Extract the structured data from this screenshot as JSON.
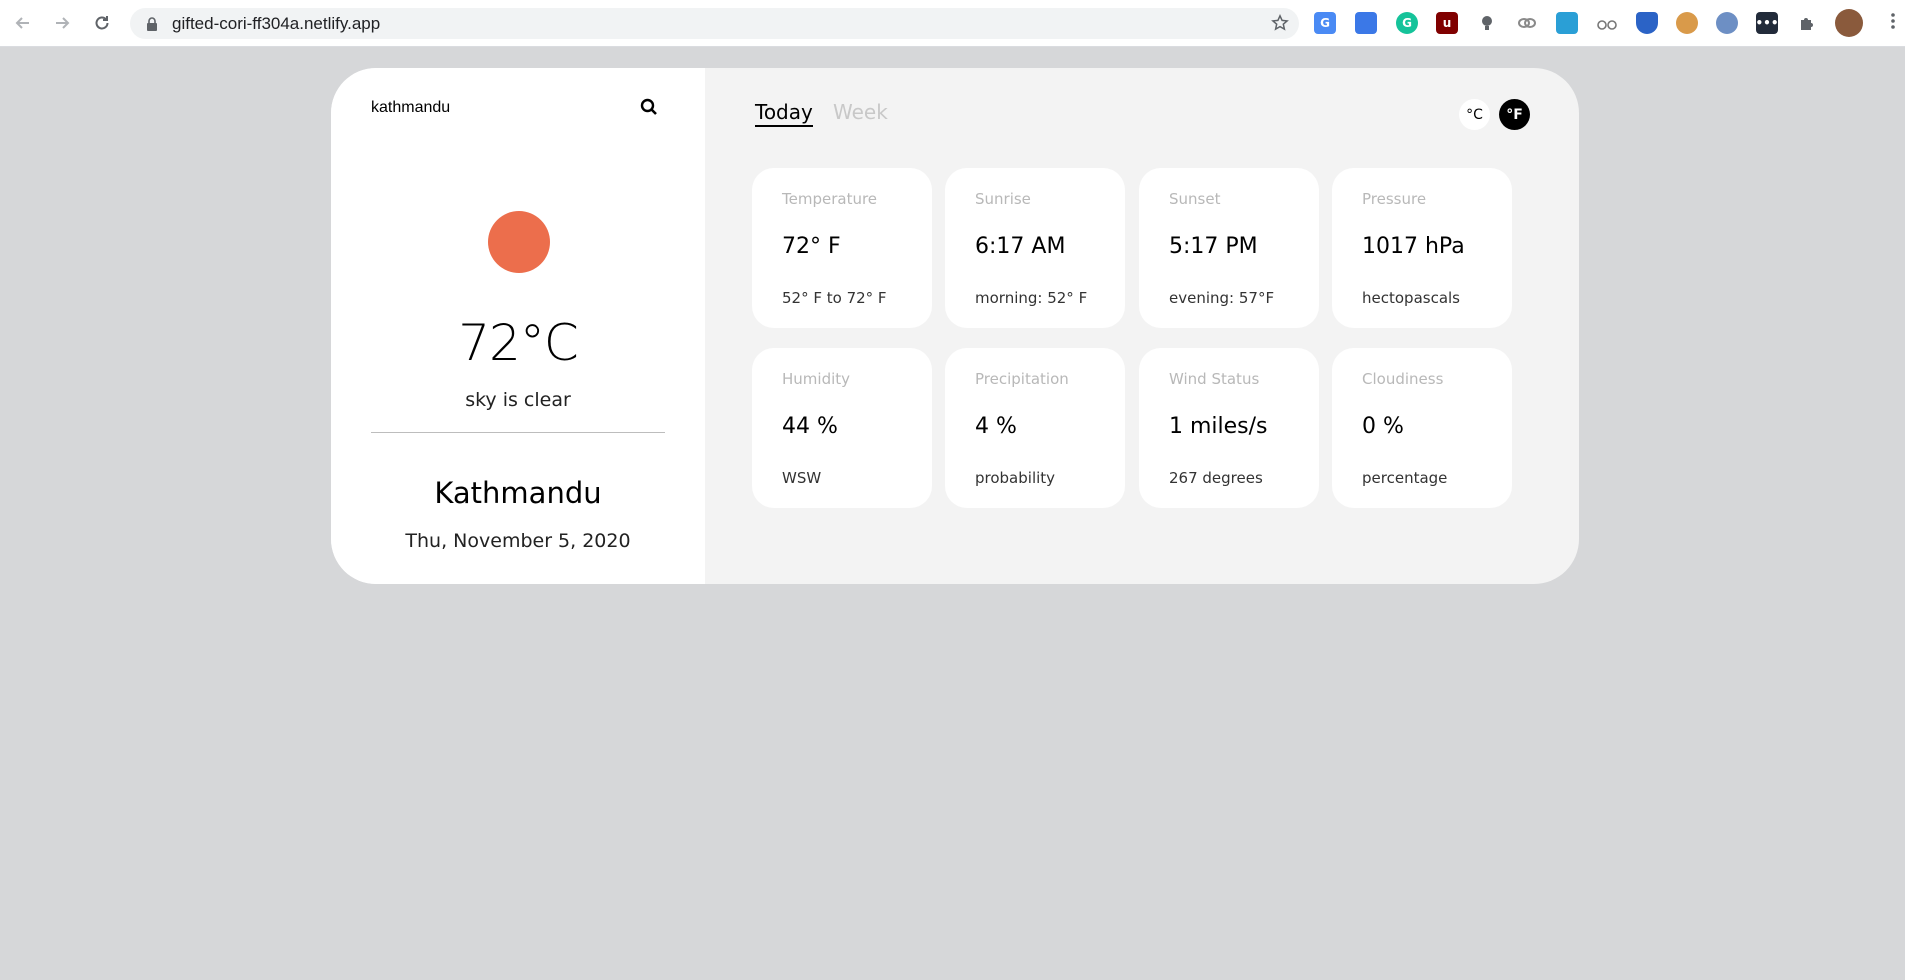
{
  "browser": {
    "url": "gifted-cori-ff304a.netlify.app"
  },
  "search": {
    "value": "kathmandu"
  },
  "current": {
    "temperature": "72°C",
    "description": "sky is clear",
    "city": "Kathmandu",
    "date": "Thu, November 5, 2020"
  },
  "tabs": {
    "today": "Today",
    "week": "Week"
  },
  "units": {
    "celsius": "°C",
    "fahrenheit": "°F"
  },
  "tiles": [
    {
      "label": "Temperature",
      "value": "72° F",
      "sub": "52° F to 72° F"
    },
    {
      "label": "Sunrise",
      "value": "6:17 AM",
      "sub": "morning: 52° F"
    },
    {
      "label": "Sunset",
      "value": "5:17 PM",
      "sub": "evening: 57°F"
    },
    {
      "label": "Pressure",
      "value": "1017 hPa",
      "sub": "hectopascals"
    },
    {
      "label": "Humidity",
      "value": "44 %",
      "sub": "WSW"
    },
    {
      "label": "Precipitation",
      "value": "4 %",
      "sub": "probability"
    },
    {
      "label": "Wind Status",
      "value": "1 miles/s",
      "sub": "267 degrees"
    },
    {
      "label": "Cloudiness",
      "value": "0 %",
      "sub": "percentage"
    }
  ],
  "colors": {
    "sun": "#ec6e4c",
    "page_background": "#d6d7d9",
    "panel_background": "#f3f3f3"
  }
}
